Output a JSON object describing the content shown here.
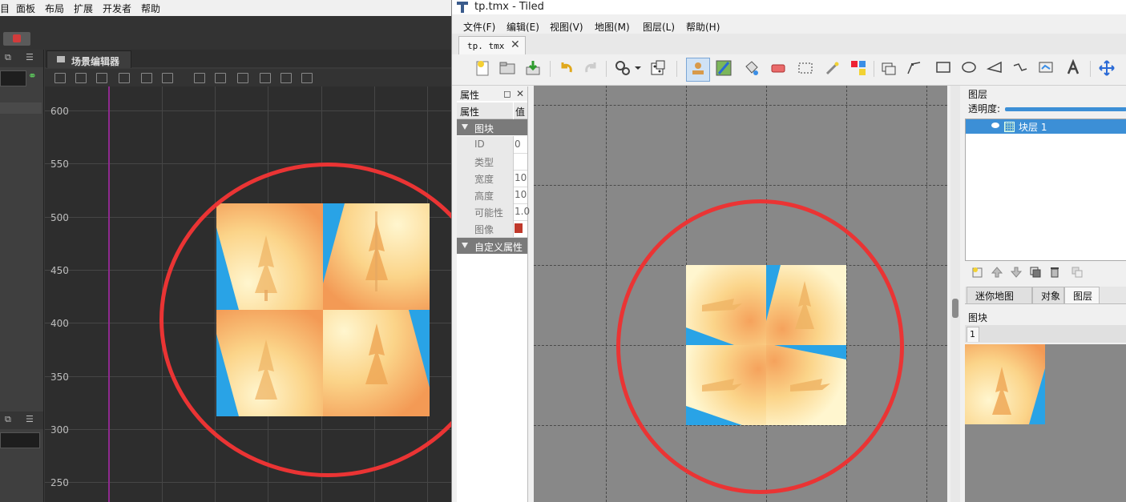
{
  "left_editor": {
    "menu": [
      "目",
      "面板",
      "布局",
      "扩展",
      "开发者",
      "帮助"
    ],
    "scene_tab_label": "场景编辑器",
    "y_axis_ticks": [
      "600",
      "550",
      "500",
      "450",
      "400",
      "350",
      "300",
      "250"
    ]
  },
  "tiled": {
    "window_title": "tp.tmx - Tiled",
    "menu": [
      "文件(F)",
      "编辑(E)",
      "视图(V)",
      "地图(M)",
      "图层(L)",
      "帮助(H)"
    ],
    "document_tab": "tp. tmx",
    "properties": {
      "panel_title": "属性",
      "col_name": "属性",
      "col_value": "值",
      "group_tile": "图块",
      "rows": [
        {
          "key": "ID",
          "value": "0"
        },
        {
          "key": "类型",
          "value": ""
        },
        {
          "key": "宽度",
          "value": "10"
        },
        {
          "key": "高度",
          "value": "10"
        },
        {
          "key": "可能性",
          "value": "1.0"
        },
        {
          "key": "图像",
          "value": ""
        }
      ],
      "group_custom": "自定义属性"
    },
    "layers": {
      "title": "图层",
      "opacity_label": "透明度:",
      "layer_name": "块层 1",
      "tabs": [
        "迷你地图",
        "对象",
        "图层"
      ],
      "active_tab": "图层"
    },
    "tileset": {
      "title": "图块",
      "tab_label": "1"
    }
  },
  "colors": {
    "annotation_circle": "#ea3434",
    "selection_blue": "#3c8fd6",
    "tile_blue": "#29a3e6",
    "tile_orange": "#f3a15a"
  }
}
